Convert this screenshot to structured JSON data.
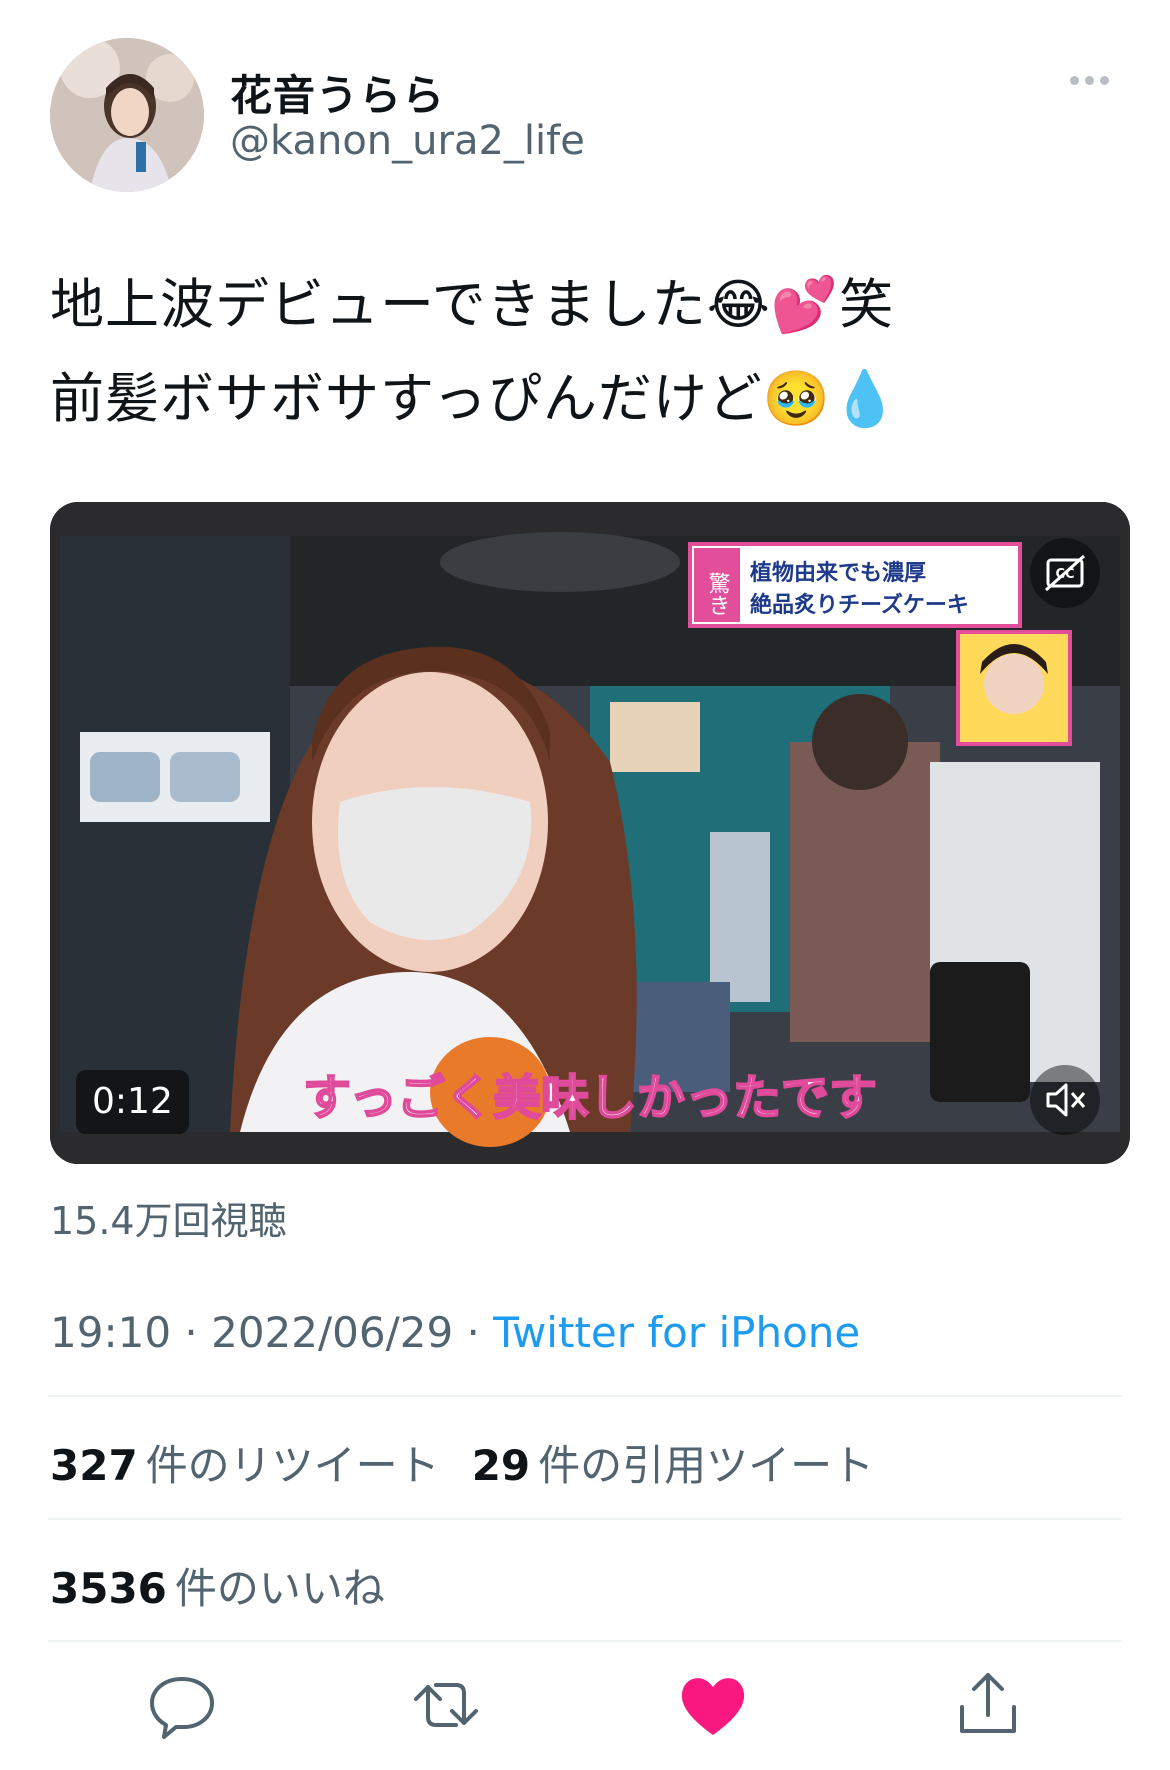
{
  "user": {
    "display_name": "花音うらら",
    "handle": "@kanon_ura2_life"
  },
  "tweet": {
    "line1": "地上波デビューできました😂💕笑",
    "line2": "前髪ボサボサすっぴんだけど🥹💧"
  },
  "video": {
    "timecode": "0:12",
    "caption": "すっごく美味しかったです",
    "banner_tag": "驚き",
    "banner_line1": "植物由来でも濃厚",
    "banner_line2": "絶品炙りチーズケーキ"
  },
  "views": "15.4万回視聴",
  "meta": {
    "time": "19:10",
    "date": "2022/06/29",
    "separator": " · ",
    "source": "Twitter for iPhone"
  },
  "stats": {
    "retweets_count": "327",
    "retweets_label": "件のリツイート",
    "quotes_count": "29",
    "quotes_label": "件の引用ツイート",
    "likes_count": "3536",
    "likes_label": "件のいいね"
  },
  "colors": {
    "accent": "#1d9bf0",
    "like": "#f91880",
    "secondary_text": "#536471"
  },
  "icons": {
    "more": "more-icon",
    "reply": "reply-icon",
    "retweet": "retweet-icon",
    "like": "heart-icon",
    "share": "share-icon",
    "captions": "cc-icon",
    "mute": "mute-icon"
  }
}
